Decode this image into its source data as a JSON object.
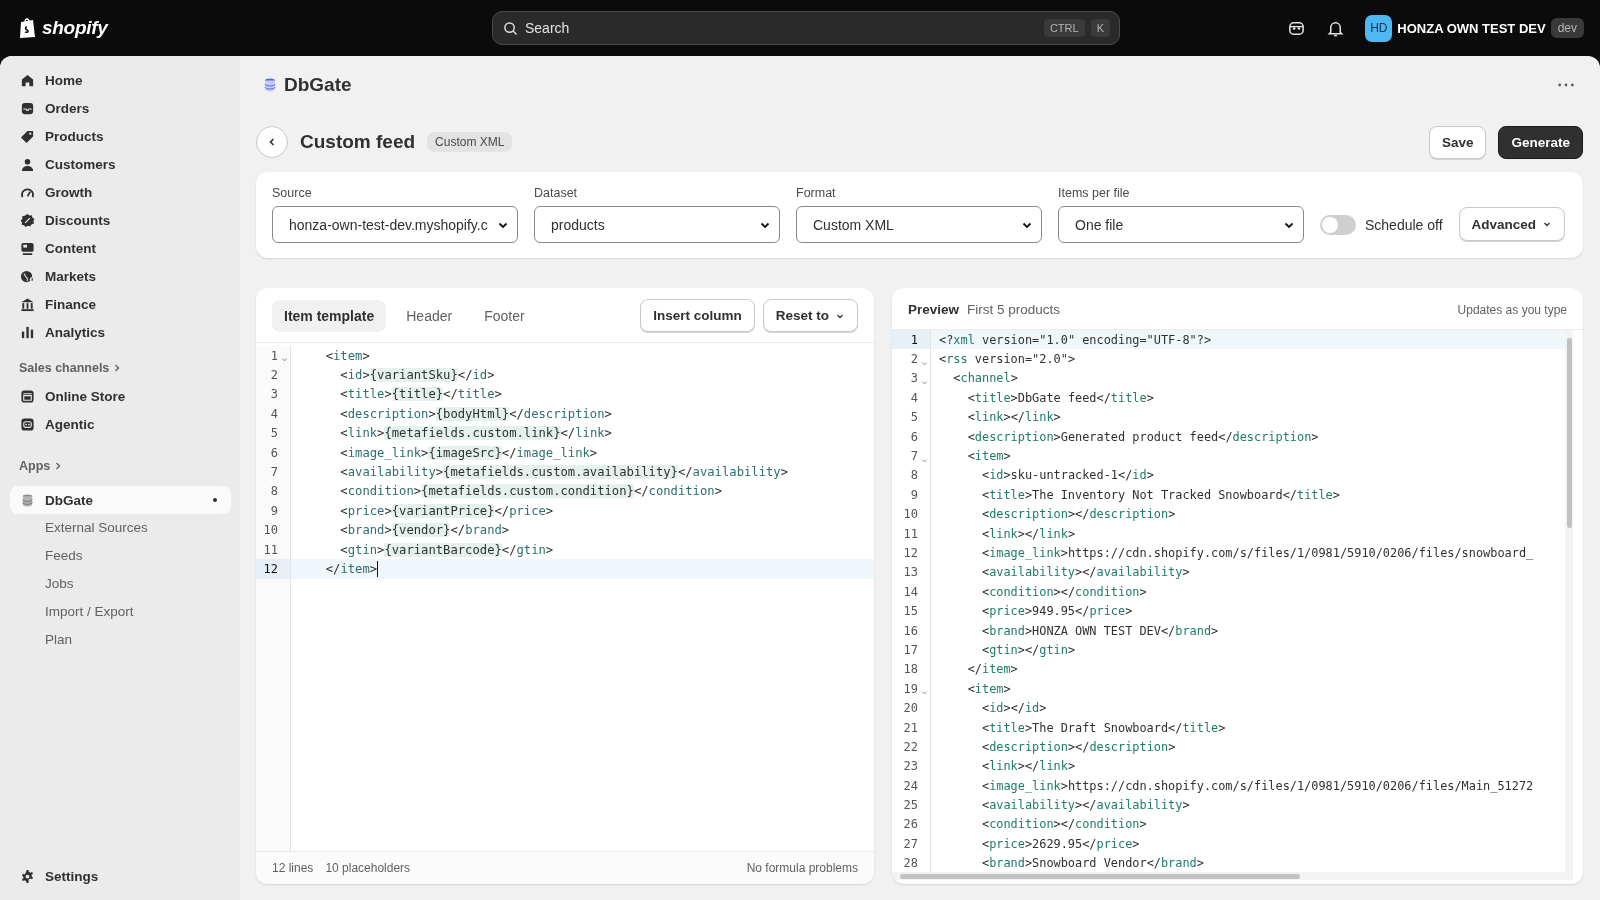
{
  "topbar": {
    "logo": "shopify",
    "search": {
      "placeholder": "Search",
      "keys": [
        "CTRL",
        "K"
      ]
    },
    "store": {
      "initials": "HD",
      "name": "HONZA OWN TEST DEV",
      "badge": "dev"
    }
  },
  "sidebar": {
    "items": [
      {
        "label": "Home",
        "selected": false
      },
      {
        "label": "Orders",
        "selected": false
      },
      {
        "label": "Products",
        "selected": false
      },
      {
        "label": "Customers",
        "selected": false
      },
      {
        "label": "Growth",
        "selected": false
      },
      {
        "label": "Discounts",
        "selected": false
      },
      {
        "label": "Content",
        "selected": false
      },
      {
        "label": "Markets",
        "selected": false
      },
      {
        "label": "Finance",
        "selected": false
      },
      {
        "label": "Analytics",
        "selected": false
      }
    ],
    "sales_channels": {
      "heading": "Sales channels",
      "items": [
        {
          "label": "Online Store",
          "selected": false
        },
        {
          "label": "Agentic",
          "selected": false
        }
      ]
    },
    "apps": {
      "heading": "Apps",
      "items": [
        {
          "label": "DbGate",
          "selected": true,
          "pinned": true,
          "children": [
            {
              "label": "External Sources",
              "selected": false
            },
            {
              "label": "Feeds",
              "selected": false
            },
            {
              "label": "Jobs",
              "selected": false
            },
            {
              "label": "Import / Export",
              "selected": false
            },
            {
              "label": "Plan",
              "selected": false
            }
          ]
        }
      ]
    },
    "settings": "Settings"
  },
  "app_title": "DbGate",
  "header": {
    "title": "Custom feed",
    "badge": "Custom XML",
    "buttons": [
      {
        "label": "Save",
        "kind": "secondary"
      },
      {
        "label": "Generate",
        "kind": "primary"
      }
    ]
  },
  "filters": {
    "selects": [
      {
        "label": "Source",
        "value": "honza-own-test-dev.myshopify.c"
      },
      {
        "label": "Dataset",
        "value": "products"
      },
      {
        "label": "Format",
        "value": "Custom XML"
      },
      {
        "label": "Items per file",
        "value": "One file"
      }
    ],
    "schedule": {
      "label": "Schedule off",
      "on": false
    },
    "advanced": "Advanced"
  },
  "editor": {
    "tabs": [
      {
        "label": "Item template",
        "selected": true
      },
      {
        "label": "Header",
        "selected": false
      },
      {
        "label": "Footer",
        "selected": false
      }
    ],
    "buttons": [
      {
        "label": "Insert column",
        "kind": "plain"
      },
      {
        "label": "Reset to",
        "kind": "menu"
      }
    ],
    "lines": [
      {
        "n": "1",
        "text": "  <item>",
        "fold": true,
        "active": false,
        "cursor": false
      },
      {
        "n": "2",
        "text": "    <id>{variantSku}</id>",
        "fold": false,
        "active": false,
        "cursor": false
      },
      {
        "n": "3",
        "text": "    <title>{title}</title>",
        "fold": false,
        "active": false,
        "cursor": false
      },
      {
        "n": "4",
        "text": "    <description>{bodyHtml}</description>",
        "fold": false,
        "active": false,
        "cursor": false
      },
      {
        "n": "5",
        "text": "    <link>{metafields.custom.link}</link>",
        "fold": false,
        "active": false,
        "cursor": false
      },
      {
        "n": "6",
        "text": "    <image_link>{imageSrc}</image_link>",
        "fold": false,
        "active": false,
        "cursor": false
      },
      {
        "n": "7",
        "text": "    <availability>{metafields.custom.availability}</availability>",
        "fold": false,
        "active": false,
        "cursor": false
      },
      {
        "n": "8",
        "text": "    <condition>{metafields.custom.condition}</condition>",
        "fold": false,
        "active": false,
        "cursor": false
      },
      {
        "n": "9",
        "text": "    <price>{variantPrice}</price>",
        "fold": false,
        "active": false,
        "cursor": false
      },
      {
        "n": "10",
        "text": "    <brand>{vendor}</brand>",
        "fold": false,
        "active": false,
        "cursor": false
      },
      {
        "n": "11",
        "text": "    <gtin>{variantBarcode}</gtin>",
        "fold": false,
        "active": false,
        "cursor": false
      },
      {
        "n": "12",
        "text": "  </item>",
        "fold": false,
        "active": true,
        "cursor": true
      }
    ],
    "status": {
      "lines": "12 lines",
      "placeholders": "10 placeholders",
      "problems": "No formula problems"
    }
  },
  "preview": {
    "title": "Preview",
    "subtitle": "First 5 products",
    "note": "Updates as you type",
    "lines": [
      {
        "n": "1",
        "text": "<?xml version=\"1.0\" encoding=\"UTF-8\"?>",
        "fold": false,
        "active": true
      },
      {
        "n": "2",
        "text": "<rss version=\"2.0\">",
        "fold": true,
        "active": false
      },
      {
        "n": "3",
        "text": "  <channel>",
        "fold": true,
        "active": false
      },
      {
        "n": "4",
        "text": "    <title>DbGate feed</title>",
        "fold": false,
        "active": false
      },
      {
        "n": "5",
        "text": "    <link></link>",
        "fold": false,
        "active": false
      },
      {
        "n": "6",
        "text": "    <description>Generated product feed</description>",
        "fold": false,
        "active": false
      },
      {
        "n": "7",
        "text": "    <item>",
        "fold": true,
        "active": false
      },
      {
        "n": "8",
        "text": "      <id>sku-untracked-1</id>",
        "fold": false,
        "active": false
      },
      {
        "n": "9",
        "text": "      <title>The Inventory Not Tracked Snowboard</title>",
        "fold": false,
        "active": false
      },
      {
        "n": "10",
        "text": "      <description></description>",
        "fold": false,
        "active": false
      },
      {
        "n": "11",
        "text": "      <link></link>",
        "fold": false,
        "active": false
      },
      {
        "n": "12",
        "text": "      <image_link>https://cdn.shopify.com/s/files/1/0981/5910/0206/files/snowboard_",
        "fold": false,
        "active": false
      },
      {
        "n": "13",
        "text": "      <availability></availability>",
        "fold": false,
        "active": false
      },
      {
        "n": "14",
        "text": "      <condition></condition>",
        "fold": false,
        "active": false
      },
      {
        "n": "15",
        "text": "      <price>949.95</price>",
        "fold": false,
        "active": false
      },
      {
        "n": "16",
        "text": "      <brand>HONZA OWN TEST DEV</brand>",
        "fold": false,
        "active": false
      },
      {
        "n": "17",
        "text": "      <gtin></gtin>",
        "fold": false,
        "active": false
      },
      {
        "n": "18",
        "text": "    </item>",
        "fold": false,
        "active": false
      },
      {
        "n": "19",
        "text": "    <item>",
        "fold": true,
        "active": false
      },
      {
        "n": "20",
        "text": "      <id></id>",
        "fold": false,
        "active": false
      },
      {
        "n": "21",
        "text": "      <title>The Draft Snowboard</title>",
        "fold": false,
        "active": false
      },
      {
        "n": "22",
        "text": "      <description></description>",
        "fold": false,
        "active": false
      },
      {
        "n": "23",
        "text": "      <link></link>",
        "fold": false,
        "active": false
      },
      {
        "n": "24",
        "text": "      <image_link>https://cdn.shopify.com/s/files/1/0981/5910/0206/files/Main_51272",
        "fold": false,
        "active": false
      },
      {
        "n": "25",
        "text": "      <availability></availability>",
        "fold": false,
        "active": false
      },
      {
        "n": "26",
        "text": "      <condition></condition>",
        "fold": false,
        "active": false
      },
      {
        "n": "27",
        "text": "      <price>2629.95</price>",
        "fold": false,
        "active": false
      },
      {
        "n": "28",
        "text": "      <brand>Snowboard Vendor</brand>",
        "fold": false,
        "active": false
      }
    ]
  }
}
